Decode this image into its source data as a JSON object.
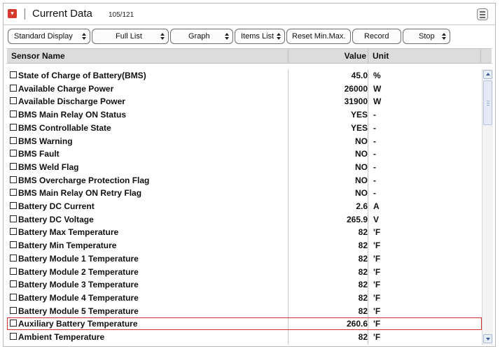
{
  "header": {
    "title": "Current Data",
    "count": "105/121"
  },
  "toolbar": {
    "standard_display": "Standard Display",
    "full_list": "Full List",
    "graph": "Graph",
    "items_list": "Items List",
    "reset_min_max": "Reset Min.Max.",
    "record": "Record",
    "stop": "Stop"
  },
  "table": {
    "col_sensor": "Sensor Name",
    "col_value": "Value",
    "col_unit": "Unit",
    "rows": [
      {
        "name": "State of Charge of Battery(BMS)",
        "value": "45.0",
        "unit": "%"
      },
      {
        "name": "Available Charge Power",
        "value": "26000",
        "unit": "W"
      },
      {
        "name": "Available Discharge Power",
        "value": "31900",
        "unit": "W"
      },
      {
        "name": "BMS Main Relay ON Status",
        "value": "YES",
        "unit": "-"
      },
      {
        "name": "BMS Controllable State",
        "value": "YES",
        "unit": "-"
      },
      {
        "name": "BMS Warning",
        "value": "NO",
        "unit": "-"
      },
      {
        "name": "BMS Fault",
        "value": "NO",
        "unit": "-"
      },
      {
        "name": "BMS Weld Flag",
        "value": "NO",
        "unit": "-"
      },
      {
        "name": "BMS Overcharge Protection Flag",
        "value": "NO",
        "unit": "-"
      },
      {
        "name": "BMS Main Relay ON Retry Flag",
        "value": "NO",
        "unit": "-"
      },
      {
        "name": "Battery DC Current",
        "value": "2.6",
        "unit": "A"
      },
      {
        "name": "Battery DC Voltage",
        "value": "265.9",
        "unit": "V"
      },
      {
        "name": "Battery Max Temperature",
        "value": "82",
        "unit": "'F"
      },
      {
        "name": "Battery Min Temperature",
        "value": "82",
        "unit": "'F"
      },
      {
        "name": "Battery Module 1 Temperature",
        "value": "82",
        "unit": "'F"
      },
      {
        "name": "Battery Module 2 Temperature",
        "value": "82",
        "unit": "'F"
      },
      {
        "name": "Battery Module 3 Temperature",
        "value": "82",
        "unit": "'F"
      },
      {
        "name": "Battery Module 4 Temperature",
        "value": "82",
        "unit": "'F"
      },
      {
        "name": "Battery Module 5 Temperature",
        "value": "82",
        "unit": "'F"
      },
      {
        "name": "Auxiliary Battery Temperature",
        "value": "260.6",
        "unit": "'F"
      },
      {
        "name": "Ambient Temperature",
        "value": "82",
        "unit": "'F"
      }
    ],
    "selected_index": 19
  },
  "colors": {
    "accent": "#d63a2f",
    "selection_border": "#d33030",
    "header_bg": "#dcdcdc"
  }
}
